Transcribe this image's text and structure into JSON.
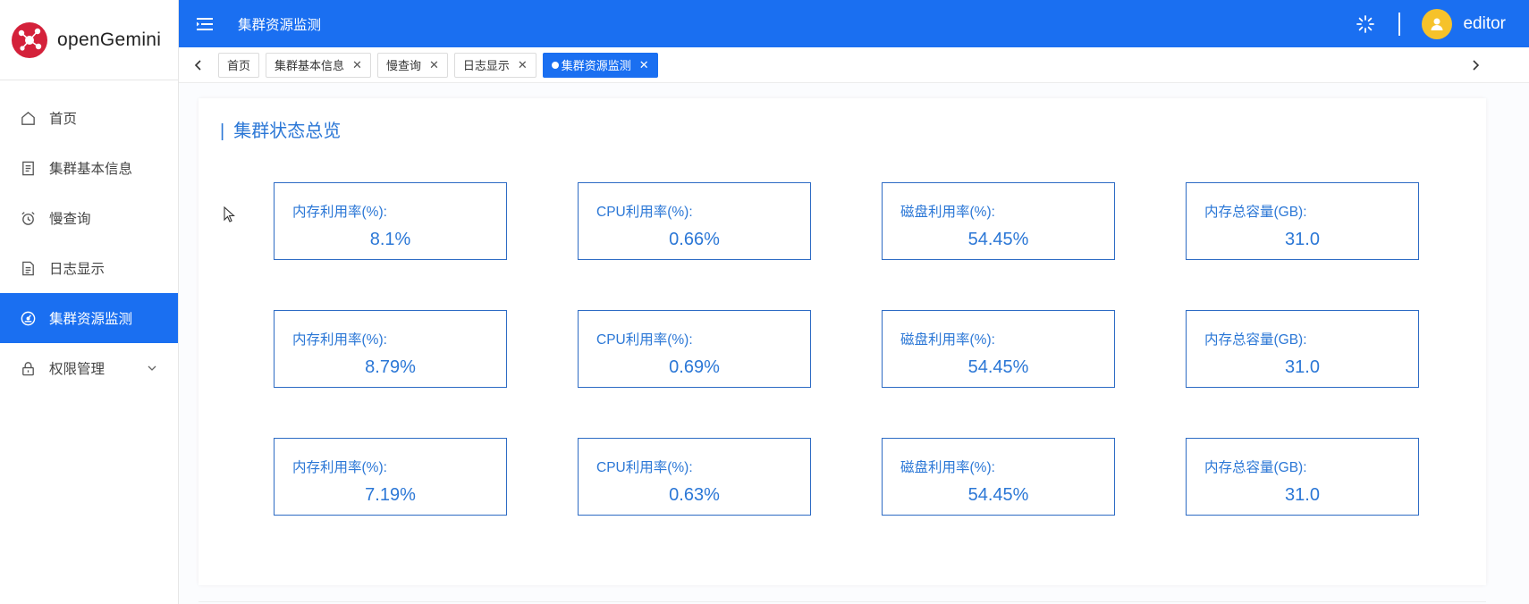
{
  "brand": {
    "name": "openGemini"
  },
  "sidebar": {
    "items": [
      {
        "label": "首页",
        "icon": "home-icon",
        "active": false
      },
      {
        "label": "集群基本信息",
        "icon": "document-icon",
        "active": false
      },
      {
        "label": "慢查询",
        "icon": "alarm-clock-icon",
        "active": false
      },
      {
        "label": "日志显示",
        "icon": "file-icon",
        "active": false
      },
      {
        "label": "集群资源监测",
        "icon": "dashboard-gauge-icon",
        "active": true
      },
      {
        "label": "权限管理",
        "icon": "lock-icon",
        "active": false,
        "expandable": true
      }
    ]
  },
  "header": {
    "title": "集群资源监测",
    "user": "editor"
  },
  "tabs": [
    {
      "label": "首页",
      "closable": false,
      "active": false
    },
    {
      "label": "集群基本信息",
      "closable": true,
      "active": false
    },
    {
      "label": "慢查询",
      "closable": true,
      "active": false
    },
    {
      "label": "日志显示",
      "closable": true,
      "active": false
    },
    {
      "label": "集群资源监测",
      "closable": true,
      "active": true
    }
  ],
  "panel": {
    "title": "集群状态总览",
    "rows": [
      [
        {
          "label": "内存利用率(%):",
          "value": "8.1%"
        },
        {
          "label": "CPU利用率(%):",
          "value": "0.66%"
        },
        {
          "label": "磁盘利用率(%):",
          "value": "54.45%"
        },
        {
          "label": "内存总容量(GB):",
          "value": "31.0"
        }
      ],
      [
        {
          "label": "内存利用率(%):",
          "value": "8.79%"
        },
        {
          "label": "CPU利用率(%):",
          "value": "0.69%"
        },
        {
          "label": "磁盘利用率(%):",
          "value": "54.45%"
        },
        {
          "label": "内存总容量(GB):",
          "value": "31.0"
        }
      ],
      [
        {
          "label": "内存利用率(%):",
          "value": "7.19%"
        },
        {
          "label": "CPU利用率(%):",
          "value": "0.63%"
        },
        {
          "label": "磁盘利用率(%):",
          "value": "54.45%"
        },
        {
          "label": "内存总容量(GB):",
          "value": "31.0"
        }
      ]
    ]
  },
  "colors": {
    "primary": "#1a6ff1",
    "card_text": "#2b77d6",
    "card_border": "#2d6bc4",
    "avatar": "#f6c22a",
    "logo": "#d4213a"
  }
}
